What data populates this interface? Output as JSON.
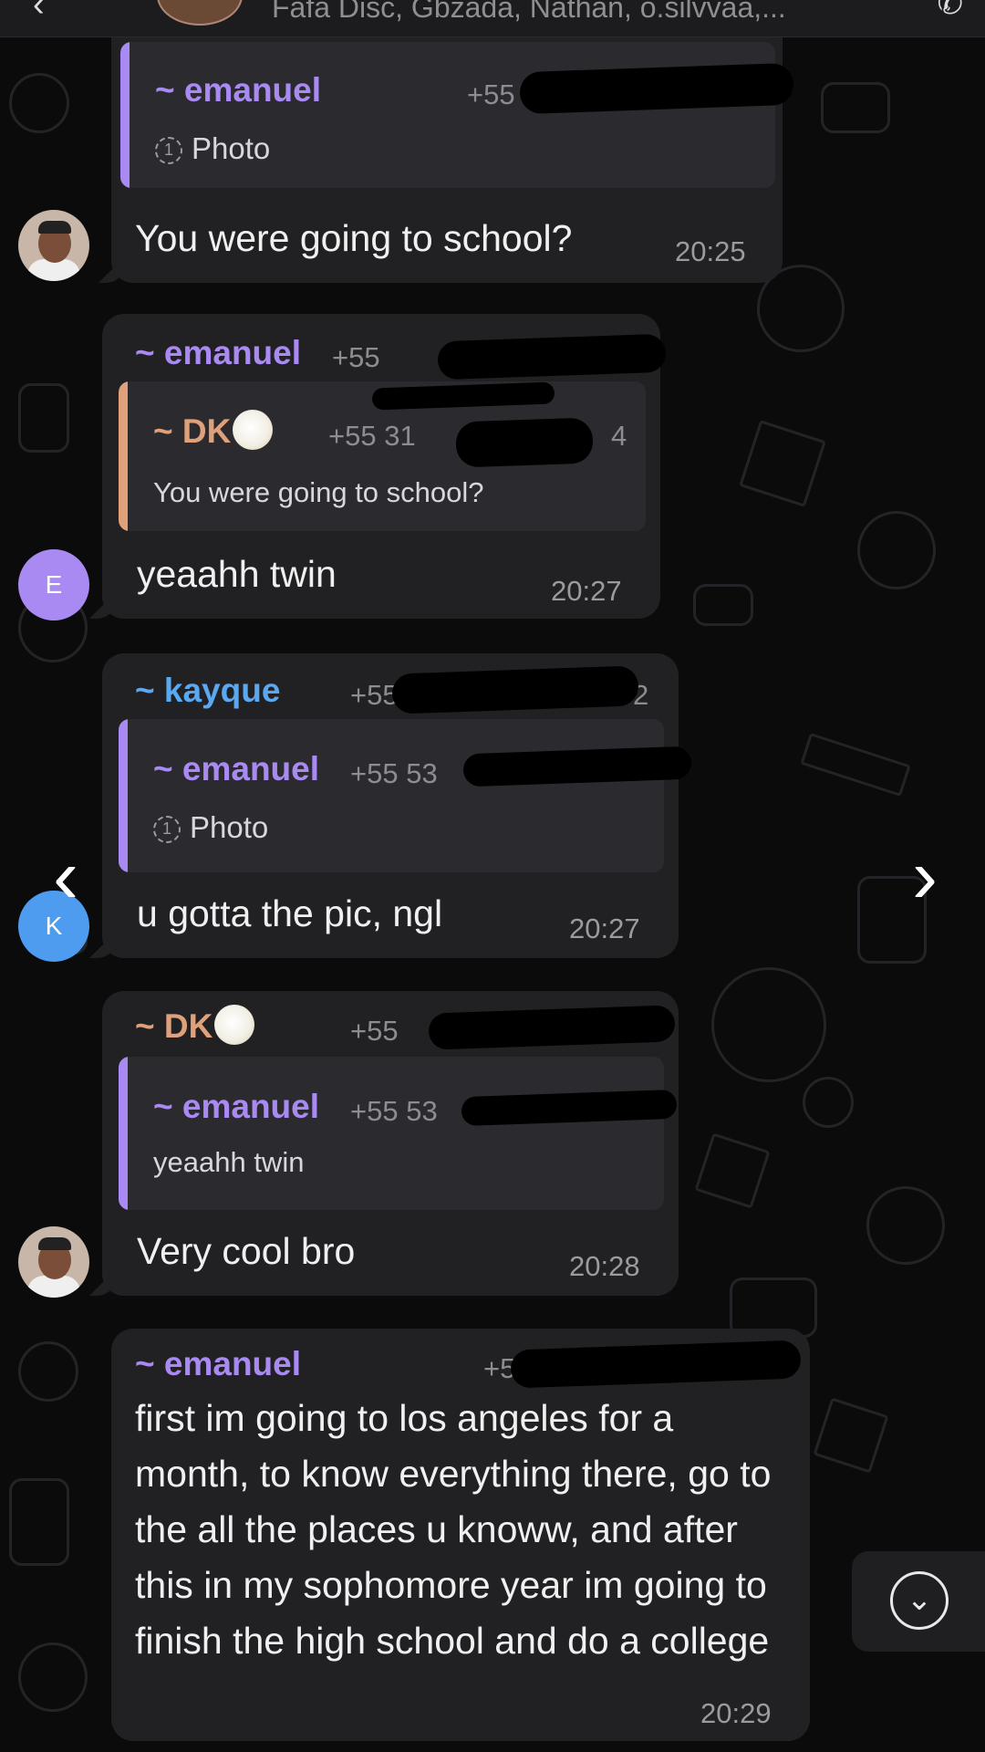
{
  "header": {
    "members": "Fafa Disc, Gbzada, Nathan, o.silvvaa,..."
  },
  "colors": {
    "emanuel": "#a98af2",
    "dk": "#e0a07a",
    "kayque": "#5aa8ef",
    "avatar_e": "#a98af2",
    "avatar_k": "#4e9cf0"
  },
  "messages": [
    {
      "quote": {
        "name": "~ emanuel",
        "phone": "+55 5",
        "text": "Photo",
        "icon": "view-once-icon"
      },
      "text": "You were going to school?",
      "time": "20:25"
    },
    {
      "sender": "~ emanuel",
      "sender_phone": "+55",
      "quote": {
        "name": "~ DK",
        "phone": "+55 31",
        "phone_end": "4",
        "text": "You were going to school?"
      },
      "text": "yeaahh twin",
      "time": "20:27",
      "avatar_letter": "E"
    },
    {
      "sender": "~ kayque",
      "sender_phone": "+55",
      "sender_phone_end": "2",
      "quote": {
        "name": "~ emanuel",
        "phone": "+55 53",
        "text": "Photo",
        "icon": "view-once-icon"
      },
      "text": "u gotta the pic, ngl",
      "time": "20:27",
      "avatar_letter": "K"
    },
    {
      "sender": "~ DK",
      "sender_phone": "+55",
      "quote": {
        "name": "~ emanuel",
        "phone": "+55 53",
        "text": "yeaahh twin"
      },
      "text": "Very cool bro",
      "time": "20:28"
    },
    {
      "sender": "~ emanuel",
      "sender_phone": "+5",
      "text": "first im going to los angeles for a month, to know everything there, go to the all the places u knoww, and after this in my sophomore year im going to finish the high school and do a college",
      "time": "20:29"
    }
  ]
}
